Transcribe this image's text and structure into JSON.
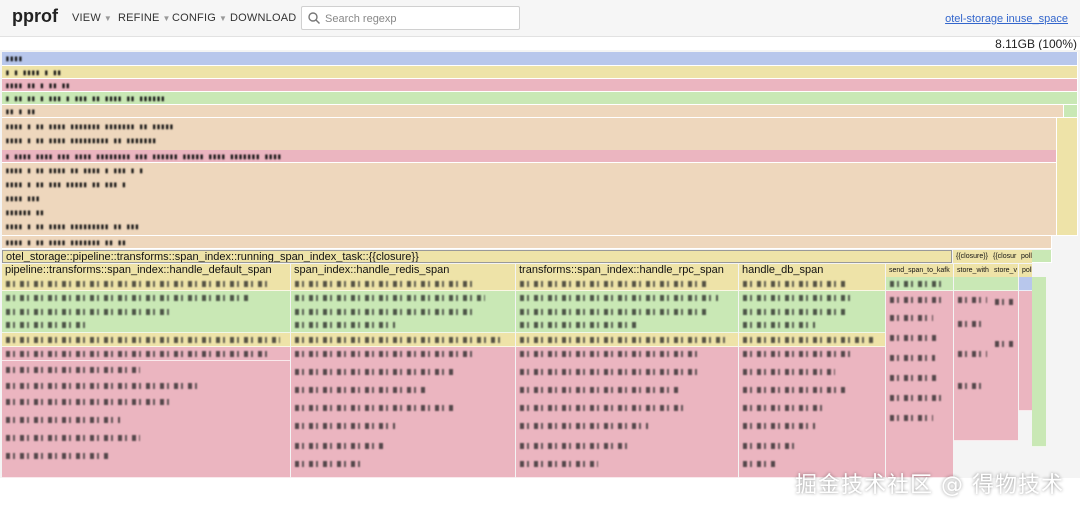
{
  "header": {
    "brand": "pprof",
    "menus": [
      {
        "label": "VIEW"
      },
      {
        "label": "REFINE"
      },
      {
        "label": "CONFIG"
      },
      {
        "label": "DOWNLOAD"
      }
    ],
    "search": {
      "placeholder": "Search regexp",
      "value": ""
    },
    "sample_link": "otel-storage inuse_space"
  },
  "summary": {
    "total": "8.11GB (100%)"
  },
  "flame": {
    "colors": {
      "root": "#b8c7ec",
      "yellow": "#eee3a8",
      "pink": "#ebb5c0",
      "green": "#c9e8b5",
      "tan": "#eed7bd"
    },
    "closure_row": {
      "label": "otel_storage::pipeline::transforms::span_index::running_span_index_task::{{closure}}",
      "small_labels": [
        "{{closure}}",
        "{{closur",
        "poll"
      ]
    },
    "columns": [
      {
        "label": "pipeline::transforms::span_index::handle_default_span"
      },
      {
        "label": "span_index::handle_redis_span"
      },
      {
        "label": "transforms::span_index::handle_rpc_span"
      },
      {
        "label": "handle_db_span"
      },
      {
        "label": "send_span_to_kafk"
      },
      {
        "label": "store_with"
      },
      {
        "label": "store_v"
      },
      {
        "label": "poll"
      }
    ]
  },
  "watermark": "掘金技术社区 @ 得物技术"
}
